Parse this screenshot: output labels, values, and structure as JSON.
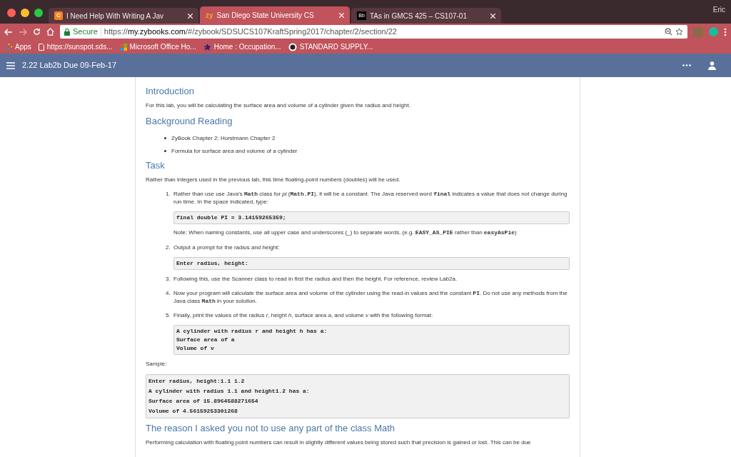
{
  "browser": {
    "tabs": [
      {
        "icon": "C",
        "label": "I Need Help With Writing A Jav",
        "selected": false
      },
      {
        "icon": "zy",
        "label": "San Diego State University CS",
        "selected": true
      },
      {
        "icon": "Bb",
        "label": "TAs in GMCS 425 – CS107-01",
        "selected": false
      }
    ],
    "profile": "Eric",
    "secure_label": "Secure",
    "url": {
      "scheme": "https://",
      "host": "my.zybooks.com",
      "path": "/#/zybook/SDSUCS107KraftSpring2017/chapter/2/section/22"
    },
    "bookmarks": [
      {
        "kind": "apps",
        "label": "Apps"
      },
      {
        "kind": "page",
        "label": "https://sunspot.sds..."
      },
      {
        "kind": "office",
        "label": "Microsoft Office Ho..."
      },
      {
        "kind": "star",
        "label": "Home : Occupation..."
      },
      {
        "kind": "logo",
        "label": "STANDARD SUPPLY..."
      }
    ]
  },
  "header": {
    "title": "2.22 Lab2b Due 09-Feb-17"
  },
  "content": [
    {
      "kind": "heading",
      "text": "Introduction"
    },
    {
      "kind": "paragraph",
      "segments": [
        {
          "kind": "text",
          "text": "For this lab, you will be calculating the surface area and volume of a cylinder given the radius and height."
        }
      ]
    },
    {
      "kind": "heading",
      "text": "Background Reading"
    },
    {
      "kind": "bullets",
      "items": [
        "ZyBook Chapter 2; Horstmann Chapter 2",
        "Formula for surface area and volume of a cylinder"
      ]
    },
    {
      "kind": "heading",
      "text": "Task"
    },
    {
      "kind": "paragraph",
      "segments": [
        {
          "kind": "text",
          "text": "Rather than integers used in the previous lab, this time floating-point numbers (doubles) will be used."
        }
      ]
    },
    {
      "kind": "step",
      "number": "1.",
      "segments": [
        {
          "kind": "text",
          "text": "Rather than use use Java's "
        },
        {
          "kind": "code",
          "text": "Math"
        },
        {
          "kind": "text",
          "text": " class for "
        },
        {
          "kind": "em",
          "text": "pi"
        },
        {
          "kind": "text",
          "text": " ("
        },
        {
          "kind": "code",
          "text": "Math.PI"
        },
        {
          "kind": "text",
          "text": "), it will be a constant. The Java reserved word "
        },
        {
          "kind": "code",
          "text": "final"
        },
        {
          "kind": "text",
          "text": " indicates a value that does not change during run time. In the space indicated, type:"
        }
      ],
      "blocks": [
        {
          "kind": "code",
          "lines": [
            "final double PI = 3.14159265359;"
          ]
        },
        {
          "kind": "paragraph",
          "segments": [
            {
              "kind": "text",
              "text": "Note: When naming constants, use all upper case and underscores (_) to separate words. (e.g. "
            },
            {
              "kind": "code",
              "text": "EASY_AS_PIE"
            },
            {
              "kind": "text",
              "text": " rather than "
            },
            {
              "kind": "code",
              "text": "easyAsPie"
            },
            {
              "kind": "text",
              "text": ")"
            }
          ]
        }
      ]
    },
    {
      "kind": "step",
      "number": "2.",
      "segments": [
        {
          "kind": "text",
          "text": "Output a prompt for the radius and height:"
        }
      ],
      "blocks": [
        {
          "kind": "code",
          "lines": [
            "Enter radius, height:"
          ]
        }
      ]
    },
    {
      "kind": "step",
      "number": "3.",
      "segments": [
        {
          "kind": "text",
          "text": "Following this, use the Scanner class to read in first the radius and then the height. For reference, review Lab2a."
        }
      ]
    },
    {
      "kind": "step",
      "number": "4.",
      "segments": [
        {
          "kind": "text",
          "text": "Now your program will calculate the surface area and volume of the cylinder using the read-in values and the constant "
        },
        {
          "kind": "code",
          "text": "PI"
        },
        {
          "kind": "text",
          "text": ". Do not use any methods from the Java class "
        },
        {
          "kind": "code",
          "text": "Math"
        },
        {
          "kind": "text",
          "text": " in your solution."
        }
      ]
    },
    {
      "kind": "step",
      "number": "5.",
      "segments": [
        {
          "kind": "text",
          "text": "Finally, print the values of the radius "
        },
        {
          "kind": "em",
          "text": "r"
        },
        {
          "kind": "text",
          "text": ", height "
        },
        {
          "kind": "em",
          "text": "h"
        },
        {
          "kind": "text",
          "text": ", surface area "
        },
        {
          "kind": "em",
          "text": "a"
        },
        {
          "kind": "text",
          "text": ", and volume "
        },
        {
          "kind": "em",
          "text": "v"
        },
        {
          "kind": "text",
          "text": " with the following format:"
        }
      ],
      "blocks": [
        {
          "kind": "code",
          "lines": [
            "A cylinder with radius r and height h has a:",
            "Surface area of a",
            "Volume of v"
          ]
        }
      ]
    },
    {
      "kind": "paragraph",
      "segments": [
        {
          "kind": "text",
          "text": "Sample:"
        }
      ]
    },
    {
      "kind": "sample_output",
      "lines": [
        "Enter radius, height:1.1 1.2",
        "A cylinder with radius 1.1 and height1.2 has a:",
        "Surface area of 15.8964588271654",
        "Volume of 4.56159253301268"
      ]
    },
    {
      "kind": "heading",
      "text": "The reason I asked you not to use any part of the class Math"
    },
    {
      "kind": "paragraph",
      "segments": [
        {
          "kind": "text",
          "text": "Performing calculation with floating point numbers can result in slightly different values being stored such that precision is gained or lost. This can be due"
        }
      ]
    }
  ]
}
